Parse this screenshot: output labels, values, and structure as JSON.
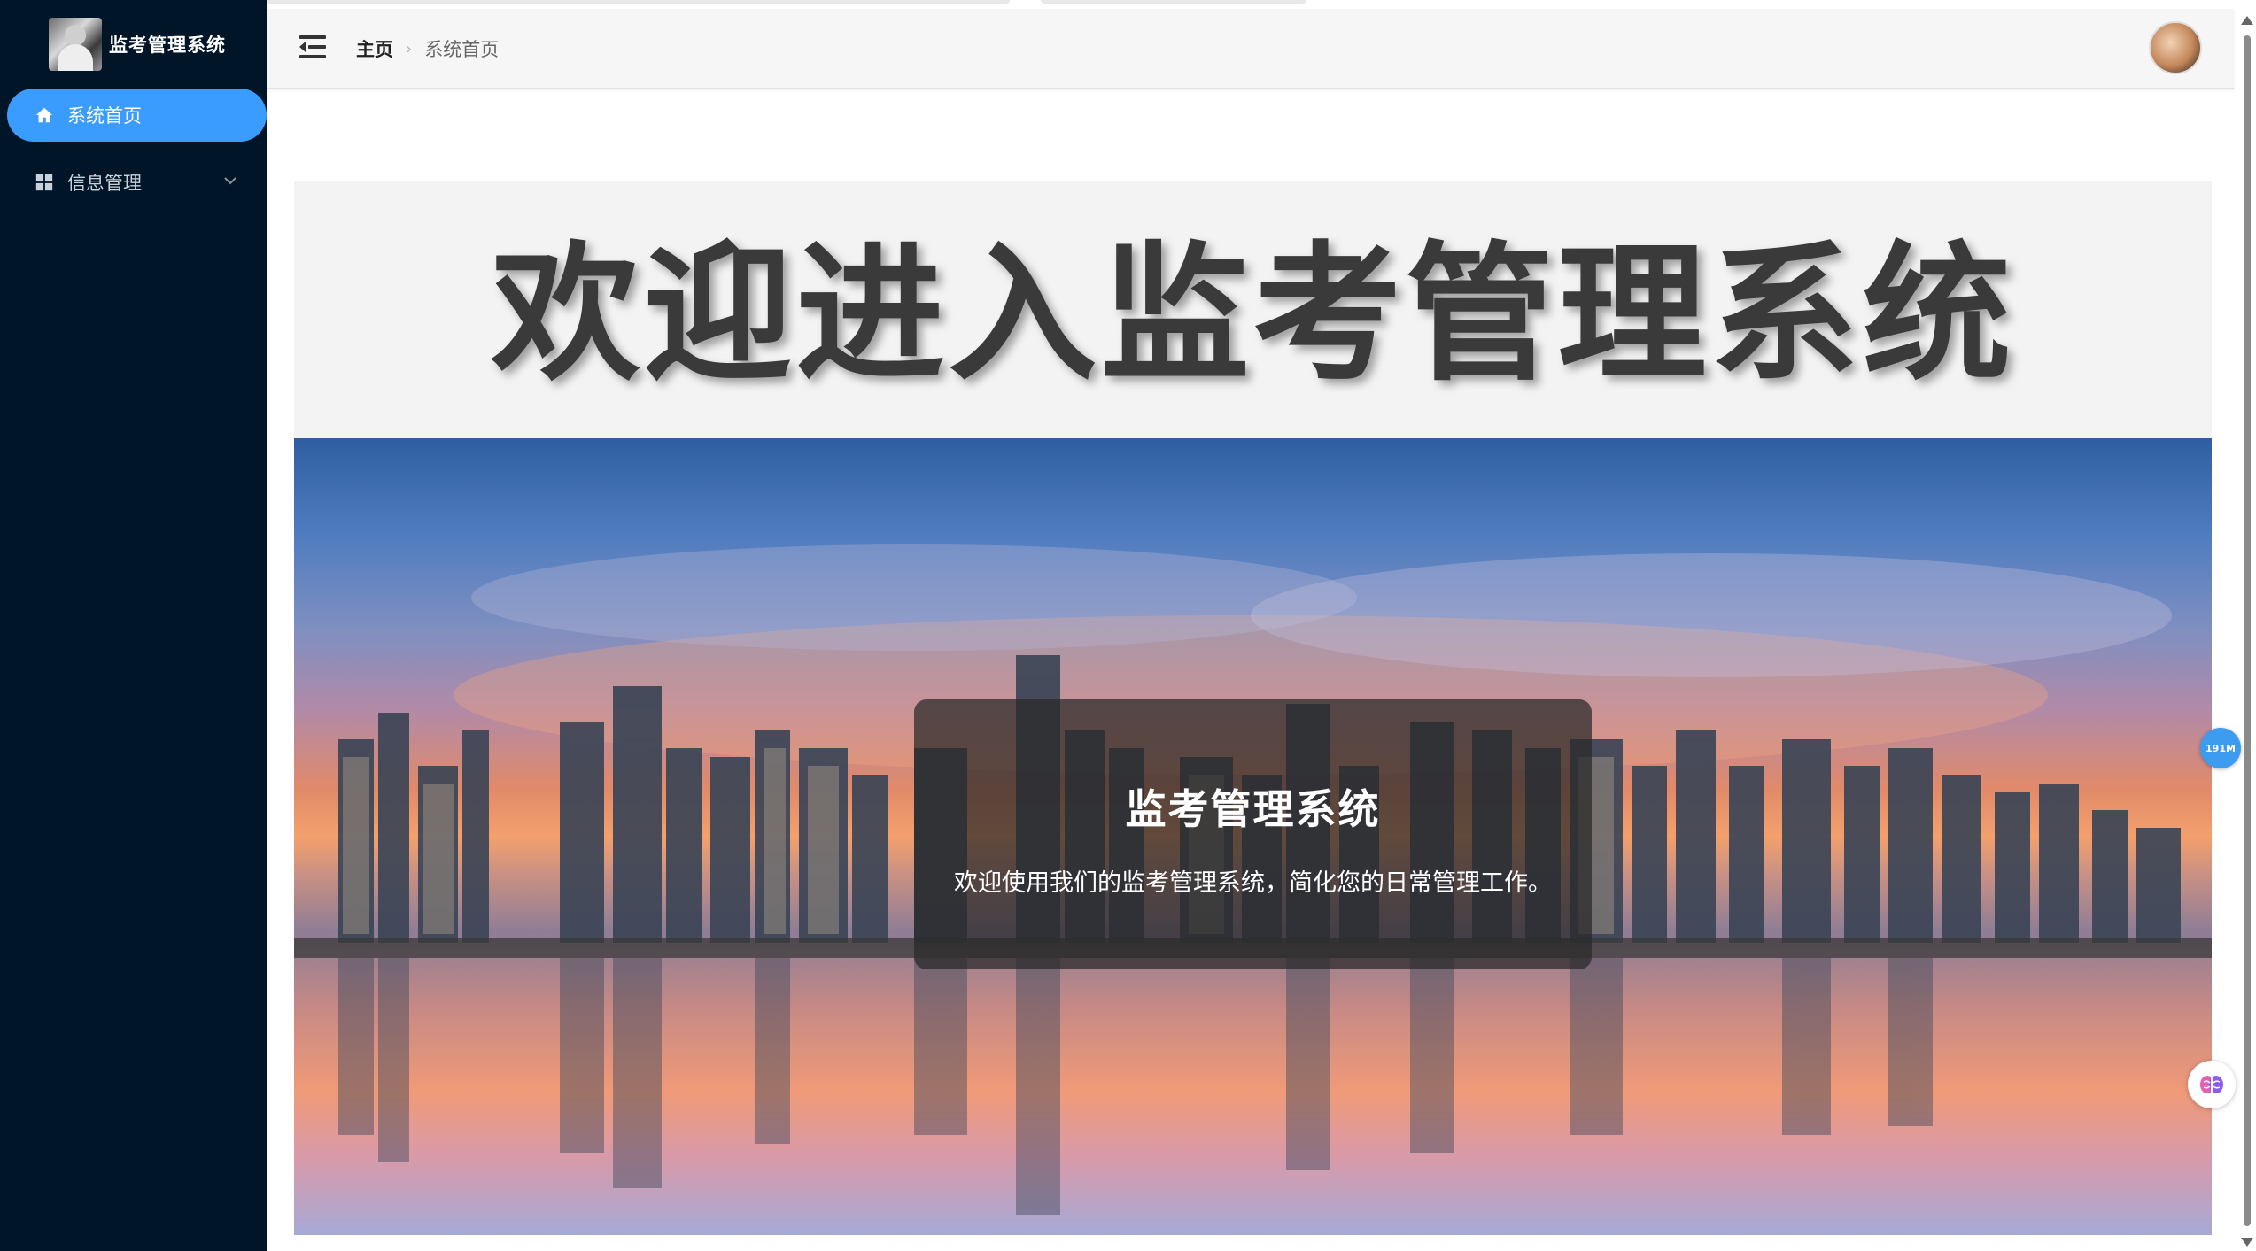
{
  "sidebar": {
    "brand_title": "监考管理系统",
    "items": [
      {
        "label": "系统首页",
        "icon": "home-icon",
        "active": true
      },
      {
        "label": "信息管理",
        "icon": "grid-icon",
        "active": false,
        "expandable": true
      }
    ],
    "background": "#011528",
    "active_color": "#3a9cff"
  },
  "header": {
    "breadcrumb": {
      "home": "主页",
      "current": "系统首页"
    }
  },
  "main": {
    "welcome_title": "欢迎进入监考管理系统",
    "card_title": "监考管理系统",
    "card_subtitle": "欢迎使用我们的监考管理系统，简化您的日常管理工作。"
  },
  "widgets": {
    "memory_badge": "191M"
  }
}
